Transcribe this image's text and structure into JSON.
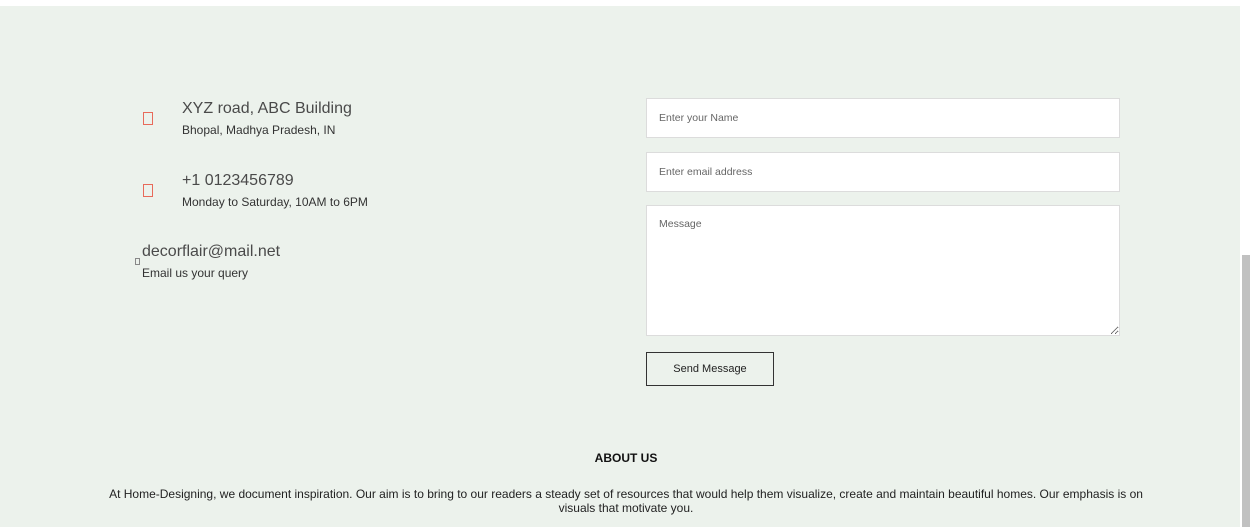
{
  "contact": {
    "address": {
      "icon": "map-marker-icon",
      "title": "XYZ road, ABC Building",
      "subtitle": "Bhopal, Madhya Pradesh, IN"
    },
    "phone": {
      "icon": "phone-icon",
      "title": "+1 0123456789",
      "subtitle": "Monday to Saturday, 10AM to 6PM"
    },
    "email": {
      "icon": "email-icon",
      "title": "decorflair@mail.net",
      "subtitle": "Email us your query"
    }
  },
  "form": {
    "name_placeholder": "Enter your Name",
    "email_placeholder": "Enter email address",
    "message_placeholder": "Message",
    "submit_label": "Send Message"
  },
  "about": {
    "heading": "ABOUT US",
    "text": "At Home-Designing, we document inspiration. Our aim is to bring to our readers a steady set of resources that would help them visualize, create and maintain beautiful homes. Our emphasis is on visuals that motivate you."
  },
  "colors": {
    "background": "#ecf2ec",
    "icon_accent": "#e86a5a"
  }
}
